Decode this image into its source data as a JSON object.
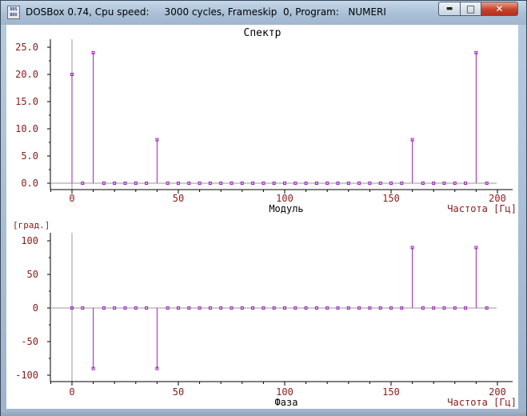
{
  "window": {
    "title": "DOSBox 0.74, Cpu speed:     3000 cycles, Frameskip  0, Program:   NUMERI",
    "icon_text_1": "DOS",
    "icon_text_2": "BOX",
    "minimize_glyph": "▬",
    "maximize_glyph": "□",
    "close_glyph": "✕"
  },
  "colors": {
    "axis_text": "#8b1a1a",
    "stem": "#a020c0",
    "axis": "#000000",
    "grid_zero": "#999999",
    "title_text": "#000000"
  },
  "chart_data": [
    {
      "type": "stem",
      "title": "Спектр",
      "xlabel": "Модуль",
      "xunit_label": "Частота [Гц]",
      "ylabel": "",
      "x_ticks": [
        "0",
        "50",
        "100",
        "150",
        "200"
      ],
      "y_ticks": [
        "0.0",
        "5.0",
        "10.0",
        "15.0",
        "20.0",
        "25.0"
      ],
      "xlim": [
        -10,
        205
      ],
      "ylim": [
        -1,
        26
      ],
      "x": [
        0,
        5,
        10,
        15,
        20,
        25,
        30,
        35,
        40,
        45,
        50,
        55,
        60,
        65,
        70,
        75,
        80,
        85,
        90,
        95,
        100,
        105,
        110,
        115,
        120,
        125,
        130,
        135,
        140,
        145,
        150,
        155,
        160,
        165,
        170,
        175,
        180,
        185,
        190,
        195
      ],
      "values": [
        20,
        0,
        24,
        0,
        0,
        0,
        0,
        0,
        8,
        0,
        0,
        0,
        0,
        0,
        0,
        0,
        0,
        0,
        0,
        0,
        0,
        0,
        0,
        0,
        0,
        0,
        0,
        0,
        0,
        0,
        0,
        0,
        8,
        0,
        0,
        0,
        0,
        0,
        24,
        0
      ]
    },
    {
      "type": "stem",
      "title": "",
      "xlabel": "Фаза",
      "xunit_label": "Частота [Гц]",
      "ylabel": "[град.]",
      "x_ticks": [
        "0",
        "50",
        "100",
        "150",
        "200"
      ],
      "y_ticks": [
        "100",
        "50",
        "0",
        "-50",
        "-100"
      ],
      "xlim": [
        -10,
        205
      ],
      "ylim": [
        -110,
        110
      ],
      "x": [
        0,
        5,
        10,
        15,
        20,
        25,
        30,
        35,
        40,
        45,
        50,
        55,
        60,
        65,
        70,
        75,
        80,
        85,
        90,
        95,
        100,
        105,
        110,
        115,
        120,
        125,
        130,
        135,
        140,
        145,
        150,
        155,
        160,
        165,
        170,
        175,
        180,
        185,
        190,
        195
      ],
      "values": [
        0,
        0,
        -90,
        0,
        0,
        0,
        0,
        0,
        -90,
        0,
        0,
        0,
        0,
        0,
        0,
        0,
        0,
        0,
        0,
        0,
        0,
        0,
        0,
        0,
        0,
        0,
        0,
        0,
        0,
        0,
        0,
        0,
        90,
        0,
        0,
        0,
        0,
        0,
        90,
        0
      ]
    }
  ]
}
